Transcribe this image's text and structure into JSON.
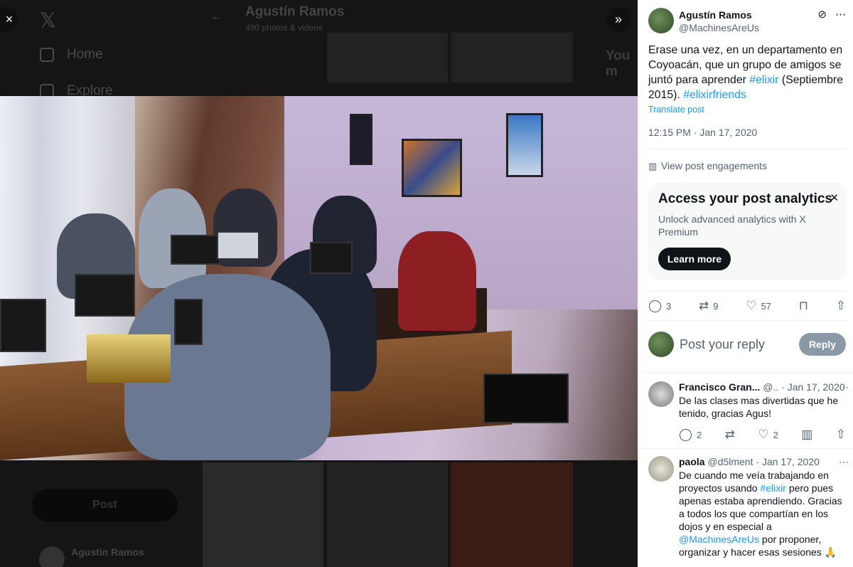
{
  "background": {
    "nav_items": [
      "Home",
      "Explore"
    ],
    "profile_name": "Agustín Ramos",
    "profile_count": "490 photos & videos",
    "post_button": "Post",
    "sidebar_heading": "You m",
    "account_name": "Agustín Ramos"
  },
  "controls": {
    "close_icon": "×",
    "expand_icon": "»"
  },
  "tweet": {
    "author_name": "Agustín Ramos",
    "author_handle": "@MachinesAreUs",
    "text_part1": "Erase una vez, en un departamento en Coyoacán, que un grupo de amigos se juntó para aprender ",
    "hashtag1": "#elixir",
    "text_part2": " (Septiembre 2015). ",
    "hashtag2": "#elixirfriends",
    "translate": "Translate post",
    "timestamp": "12:15 PM · Jan 17, 2020",
    "view_engagements": "View post engagements",
    "stats": {
      "replies": "3",
      "reposts": "9",
      "likes": "57"
    }
  },
  "promo": {
    "title": "Access your post analytics",
    "subtitle": "Unlock advanced analytics with X Premium",
    "button": "Learn more"
  },
  "composer": {
    "placeholder": "Post your reply",
    "button": "Reply"
  },
  "replies": [
    {
      "name": "Francisco Gran...",
      "handle": "@..",
      "date": "· Jan 17, 2020",
      "text": "De las clases mas divertidas que he tenido, gracias Agus!",
      "replies": "2",
      "likes": "2"
    },
    {
      "name": "paola",
      "handle": "@d5lment",
      "date": "· Jan 17, 2020",
      "text_part1": "De cuando me veía trabajando en proyectos usando ",
      "hashtag": "#elixir",
      "text_part2": " pero pues apenas estaba aprendiendo. Gracias a todos los que compartían en los dojos y en especial a ",
      "mention": "@MachinesAreUs",
      "text_part3": " por proponer, organizar y hacer esas sesiones 🙏"
    }
  ]
}
